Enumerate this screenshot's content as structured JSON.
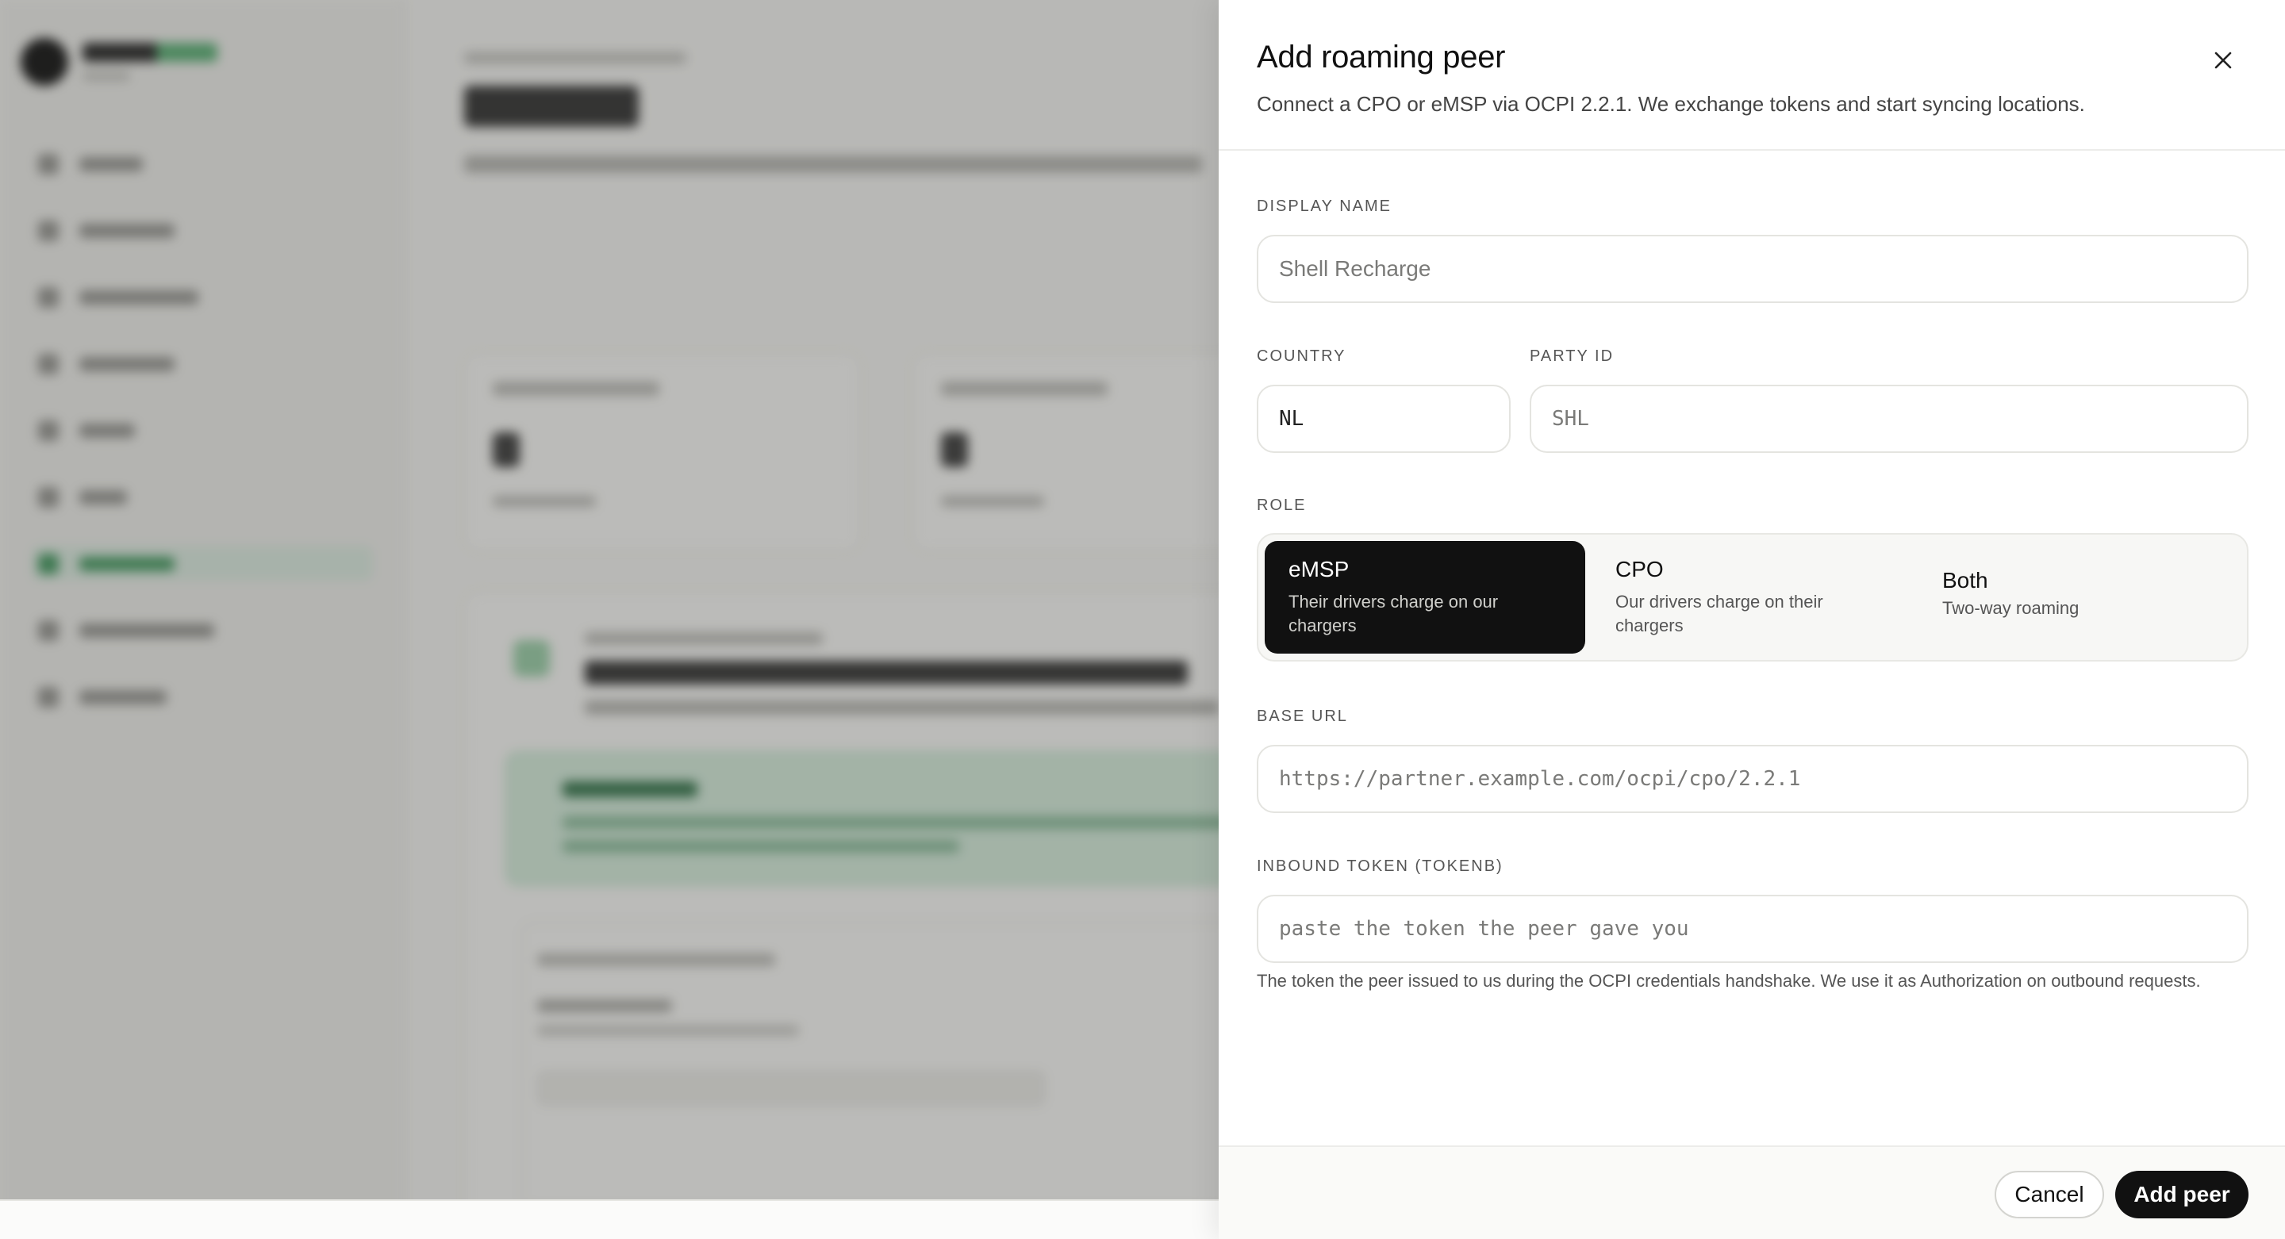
{
  "dialog": {
    "title": "Add roaming peer",
    "subtitle": "Connect a CPO or eMSP via OCPI 2.2.1. We exchange tokens and start syncing locations.",
    "close_icon": "close-icon"
  },
  "form": {
    "display_name": {
      "label": "DISPLAY NAME",
      "value": "",
      "placeholder": "Shell Recharge"
    },
    "country": {
      "label": "COUNTRY",
      "value": "NL",
      "placeholder": ""
    },
    "party_id": {
      "label": "PARTY ID",
      "value": "",
      "placeholder": "SHL"
    },
    "role": {
      "label": "ROLE",
      "selected": "eMSP",
      "options": [
        {
          "name": "eMSP",
          "desc": "Their drivers charge on our chargers"
        },
        {
          "name": "CPO",
          "desc": "Our drivers charge on their chargers"
        },
        {
          "name": "Both",
          "desc": "Two-way roaming"
        }
      ]
    },
    "base_url": {
      "label": "BASE URL",
      "value": "",
      "placeholder": "https://partner.example.com/ocpi/cpo/2.2.1"
    },
    "inbound_token": {
      "label": "INBOUND TOKEN (TOKENB)",
      "value": "",
      "placeholder": "paste the token the peer gave you",
      "help": "The token the peer issued to us during the OCPI credentials handshake. We use it as Authorization on outbound requests."
    }
  },
  "footer": {
    "cancel_label": "Cancel",
    "submit_label": "Add peer"
  },
  "colors": {
    "primary": "#111111",
    "border": "#e4e4e0",
    "muted_text": "#555555",
    "backdrop_accent": "#4a9d66"
  }
}
